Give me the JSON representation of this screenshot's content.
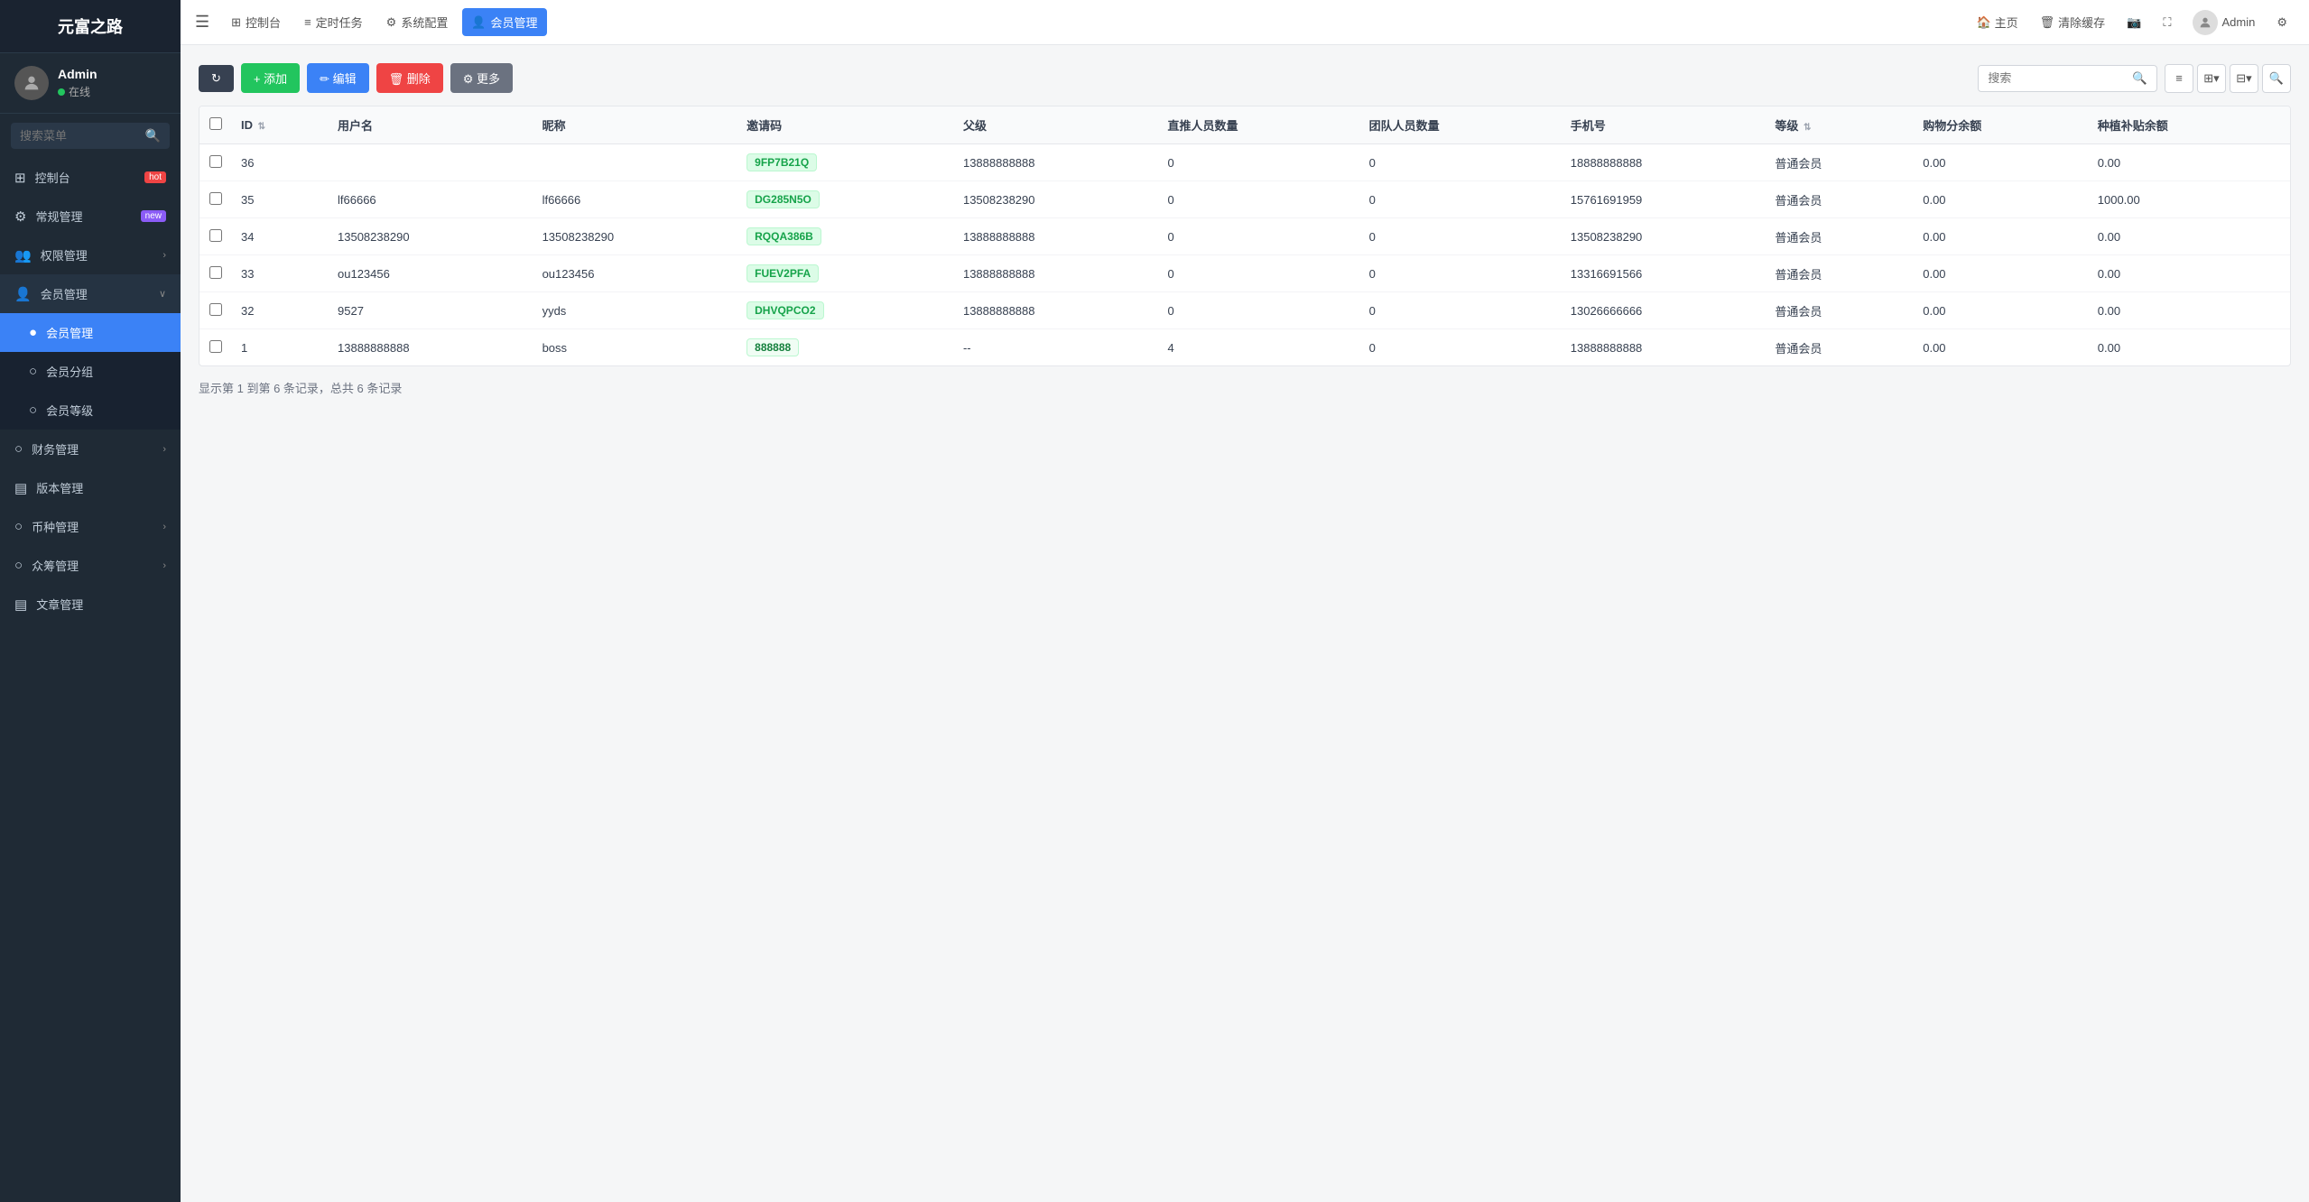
{
  "app": {
    "title": "元富之路"
  },
  "sidebar": {
    "user": {
      "name": "Admin",
      "status": "在线"
    },
    "search_placeholder": "搜索菜单",
    "items": [
      {
        "id": "dashboard",
        "label": "控制台",
        "badge": "hot",
        "badge_type": "hot",
        "icon": "⊞"
      },
      {
        "id": "general",
        "label": "常规管理",
        "badge": "new",
        "badge_type": "new",
        "icon": "⚙"
      },
      {
        "id": "permissions",
        "label": "权限管理",
        "has_arrow": true,
        "icon": "👥"
      },
      {
        "id": "members",
        "label": "会员管理",
        "has_arrow": true,
        "icon": "👤",
        "expanded": true
      },
      {
        "id": "member-manage",
        "label": "会员管理",
        "sub": true,
        "active": true,
        "icon": ""
      },
      {
        "id": "member-group",
        "label": "会员分组",
        "sub": true,
        "icon": ""
      },
      {
        "id": "member-level",
        "label": "会员等级",
        "sub": true,
        "icon": ""
      },
      {
        "id": "finance",
        "label": "财务管理",
        "has_arrow": true,
        "icon": "○"
      },
      {
        "id": "version",
        "label": "版本管理",
        "icon": "▤"
      },
      {
        "id": "currency",
        "label": "币种管理",
        "has_arrow": true,
        "icon": "○"
      },
      {
        "id": "crowdfund",
        "label": "众筹管理",
        "has_arrow": true,
        "icon": "○"
      },
      {
        "id": "article",
        "label": "文章管理",
        "icon": "▤"
      }
    ]
  },
  "topnav": {
    "items": [
      {
        "id": "dashboard-nav",
        "label": "控制台",
        "icon": "⊞"
      },
      {
        "id": "scheduled-nav",
        "label": "定时任务",
        "icon": "≡"
      },
      {
        "id": "sysconfig-nav",
        "label": "系统配置",
        "icon": "⚙"
      },
      {
        "id": "member-nav",
        "label": "会员管理",
        "icon": "👤",
        "active": true
      }
    ],
    "right": {
      "home": "主页",
      "clear_cache": "清除缓存",
      "admin": "Admin"
    }
  },
  "toolbar": {
    "refresh_label": "",
    "add_label": "+ 添加",
    "edit_label": "✏ 编辑",
    "delete_label": "🗑 删除",
    "more_label": "⚙ 更多",
    "search_placeholder": "搜索"
  },
  "table": {
    "columns": [
      {
        "id": "id",
        "label": "ID"
      },
      {
        "id": "username",
        "label": "用户名"
      },
      {
        "id": "nickname",
        "label": "昵称"
      },
      {
        "id": "invite_code",
        "label": "邀请码"
      },
      {
        "id": "parent",
        "label": "父级"
      },
      {
        "id": "direct_count",
        "label": "直推人员数量"
      },
      {
        "id": "team_count",
        "label": "团队人员数量"
      },
      {
        "id": "phone",
        "label": "手机号"
      },
      {
        "id": "level",
        "label": "等级"
      },
      {
        "id": "shopping_balance",
        "label": "购物分余额"
      },
      {
        "id": "plant_balance",
        "label": "种植补贴余额"
      }
    ],
    "rows": [
      {
        "id": "36",
        "username": "",
        "nickname": "",
        "invite_code": "9FP7B21Q",
        "invite_badge": "badge-green",
        "parent": "13888888888",
        "direct_count": "0",
        "team_count": "0",
        "phone": "18888888888",
        "level": "普通会员",
        "shopping_balance": "0.00",
        "plant_balance": "0.00"
      },
      {
        "id": "35",
        "username": "lf66666",
        "nickname": "lf66666",
        "invite_code": "DG285N5O",
        "invite_badge": "badge-green",
        "parent": "13508238290",
        "direct_count": "0",
        "team_count": "0",
        "phone": "15761691959",
        "level": "普通会员",
        "shopping_balance": "0.00",
        "plant_balance": "1000.00"
      },
      {
        "id": "34",
        "username": "13508238290",
        "nickname": "13508238290",
        "invite_code": "RQQA386B",
        "invite_badge": "badge-green",
        "parent": "13888888888",
        "direct_count": "0",
        "team_count": "0",
        "phone": "13508238290",
        "level": "普通会员",
        "shopping_balance": "0.00",
        "plant_balance": "0.00"
      },
      {
        "id": "33",
        "username": "ou123456",
        "nickname": "ou123456",
        "invite_code": "FUEV2PFA",
        "invite_badge": "badge-green",
        "parent": "13888888888",
        "direct_count": "0",
        "team_count": "0",
        "phone": "13316691566",
        "level": "普通会员",
        "shopping_balance": "0.00",
        "plant_balance": "0.00"
      },
      {
        "id": "32",
        "username": "9527",
        "nickname": "yyds",
        "invite_code": "DHVQPCO2",
        "invite_badge": "badge-green",
        "parent": "13888888888",
        "direct_count": "0",
        "team_count": "0",
        "phone": "13026666666",
        "level": "普通会员",
        "shopping_balance": "0.00",
        "plant_balance": "0.00"
      },
      {
        "id": "1",
        "username": "13888888888",
        "nickname": "boss",
        "invite_code": "888888",
        "invite_badge": "badge-light-green",
        "parent": "--",
        "direct_count": "4",
        "team_count": "0",
        "phone": "13888888888",
        "level": "普通会员",
        "shopping_balance": "0.00",
        "plant_balance": "0.00"
      }
    ],
    "pagination": "显示第 1 到第 6 条记录，总共 6 条记录"
  },
  "colors": {
    "sidebar_bg": "#1f2a35",
    "active_blue": "#3b82f6",
    "green": "#22c55e"
  }
}
